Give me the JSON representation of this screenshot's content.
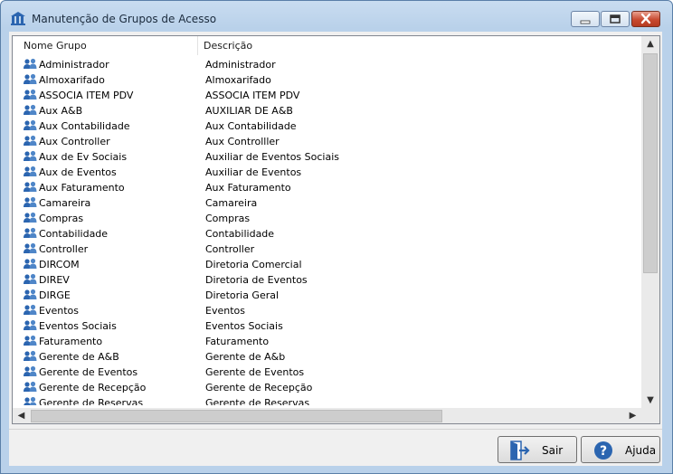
{
  "window": {
    "title": "Manutenção de Grupos de Acesso",
    "icon": "group-access-icon",
    "controls": [
      "minimize-icon",
      "maximize-icon",
      "close-icon"
    ]
  },
  "list": {
    "columns": [
      "Nome Grupo",
      "Descrição"
    ],
    "row_icon": "users-group-icon",
    "rows": [
      {
        "name": "Administrador",
        "desc": "Administrador"
      },
      {
        "name": "Almoxarifado",
        "desc": "Almoxarifado"
      },
      {
        "name": "ASSOCIA ITEM PDV",
        "desc": "ASSOCIA ITEM PDV"
      },
      {
        "name": "Aux A&B",
        "desc": "AUXILIAR DE A&B"
      },
      {
        "name": "Aux Contabilidade",
        "desc": "Aux Contabilidade"
      },
      {
        "name": "Aux Controller",
        "desc": "Aux Controlller"
      },
      {
        "name": "Aux de Ev Sociais",
        "desc": "Auxiliar de Eventos Sociais"
      },
      {
        "name": "Aux de Eventos",
        "desc": "Auxiliar de Eventos"
      },
      {
        "name": "Aux Faturamento",
        "desc": "Aux Faturamento"
      },
      {
        "name": "Camareira",
        "desc": "Camareira"
      },
      {
        "name": "Compras",
        "desc": "Compras"
      },
      {
        "name": "Contabilidade",
        "desc": "Contabilidade"
      },
      {
        "name": "Controller",
        "desc": "Controller"
      },
      {
        "name": "DIRCOM",
        "desc": "Diretoria Comercial"
      },
      {
        "name": "DIREV",
        "desc": "Diretoria de Eventos"
      },
      {
        "name": "DIRGE",
        "desc": "Diretoria Geral"
      },
      {
        "name": "Eventos",
        "desc": "Eventos"
      },
      {
        "name": "Eventos Sociais",
        "desc": "Eventos Sociais"
      },
      {
        "name": "Faturamento",
        "desc": "Faturamento"
      },
      {
        "name": "Gerente de A&B",
        "desc": "Gerente de A&b"
      },
      {
        "name": "Gerente de Eventos",
        "desc": "Gerente de Eventos"
      },
      {
        "name": "Gerente de Recepção",
        "desc": "Gerente de Recepção"
      },
      {
        "name": "Gerente de Reservas",
        "desc": "Gerente de Reservas"
      }
    ]
  },
  "buttons": {
    "exit": {
      "label": "Sair",
      "icon": "exit-door-icon"
    },
    "help": {
      "label": "Ajuda",
      "icon": "help-question-icon"
    }
  },
  "colors": {
    "accent": "#2b65b0",
    "close_button": "#c84a30",
    "frame": "#b9d1ea"
  }
}
